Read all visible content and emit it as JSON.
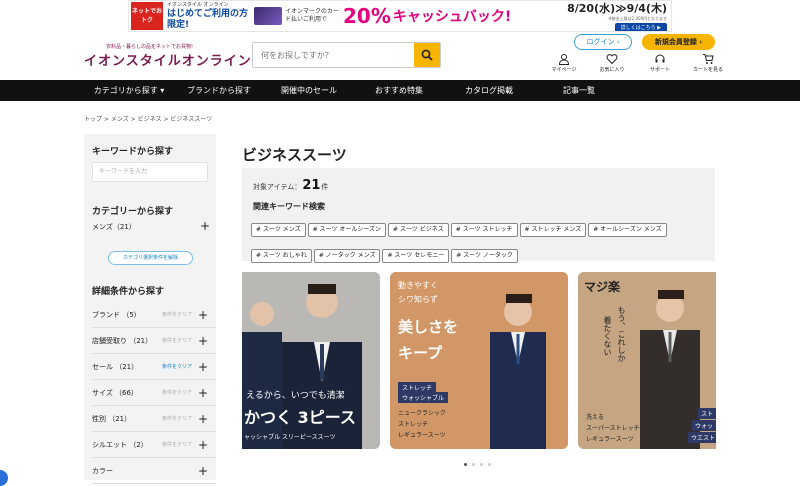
{
  "banner": {
    "tag": "ネットでおトク",
    "line1": "イオンスタイル オンライン",
    "line2": "はじめてご利用の方限定!",
    "card_text": "イオンマークのカード払いご利用で",
    "percent": "20%",
    "cashback": "キャッシュバック!",
    "dates": "8/20(水)≫9/4(木)",
    "note": "※総金上限は2,000円となります",
    "details": "詳しくはこちら ▶"
  },
  "logo": {
    "tagline": "衣料品・暮らしの品をネットでお買物!",
    "name": "イオンスタイルオンライン"
  },
  "search": {
    "placeholder": "何をお探しですか？"
  },
  "header": {
    "login": "ログイン ›",
    "register": "新規会員登録 ›",
    "icons": [
      {
        "label": "マイページ",
        "icon": "user-icon"
      },
      {
        "label": "お気に入り",
        "icon": "heart-icon"
      },
      {
        "label": "サポート",
        "icon": "support-icon"
      },
      {
        "label": "カートを見る",
        "icon": "cart-icon"
      }
    ]
  },
  "nav": [
    "カテゴリから探す ▾",
    "ブランドから探す",
    "開催中のセール",
    "おすすめ特集",
    "カタログ掲載",
    "記事一覧"
  ],
  "breadcrumb": "トップ > メンズ > ビジネス > ビジネススーツ",
  "sidebar": {
    "keyword_title": "キーワードから探す",
    "keyword_placeholder": "キーワードを入力",
    "category_title": "カテゴリーから探す",
    "category_item": "メンズ（21）",
    "reset": "カテゴリ選択条件を解除",
    "detail_title": "詳細条件から探す",
    "filters": [
      {
        "label": "ブランド （5）",
        "clear": "条件をクリア",
        "active": false
      },
      {
        "label": "店舗受取り （21）",
        "clear": "条件をクリア",
        "active": false
      },
      {
        "label": "セール （21）",
        "clear": "条件をクリア",
        "active": true
      },
      {
        "label": "サイズ （66）",
        "clear": "条件をクリア",
        "active": false
      },
      {
        "label": "性別 （21）",
        "clear": "条件をクリア",
        "active": false
      },
      {
        "label": "シルエット （2）",
        "clear": "条件をクリア",
        "active": false
      },
      {
        "label": "カラー",
        "clear": "",
        "active": false
      }
    ]
  },
  "main": {
    "title": "ビジネススーツ",
    "count_label": "対象アイテム：",
    "count": "21",
    "count_unit": "件",
    "related_title": "関連キーワード検索",
    "tags": [
      "# スーツ メンズ",
      "# スーツ オールシーズン",
      "# スーツ ビジネス",
      "# スーツ ストレッチ",
      "# ストレッチ メンズ",
      "# オールシーズン メンズ",
      "# スーツ おしゃれ",
      "# ノータック メンズ",
      "# スーツ セレモニー",
      "# スーツ ノータック"
    ]
  },
  "slides": [
    {
      "line1": "えるから、いつでも清潔",
      "line2": "かつく 3ピース",
      "line3": "ャッシャブル スリーピーススーツ"
    },
    {
      "line1": "動きやすく",
      "line2": "シワ知らず",
      "line3": "美しさを",
      "line4": "キープ",
      "badge1": "ストレッチ",
      "badge2": "ウォッシャブル",
      "sub1": "ニュークラシック",
      "sub2": "ストレッチ",
      "sub3": "レギュラースーツ"
    },
    {
      "logo": "マジ楽",
      "v1": "もう、これしか",
      "v2": "着たくない",
      "sub1": "洗える",
      "sub2": "スーパーストレッチ",
      "sub3": "レギュラースーツ",
      "badge1": "スト",
      "badge2": "ウォッ",
      "badge3": "ウエスト"
    }
  ]
}
